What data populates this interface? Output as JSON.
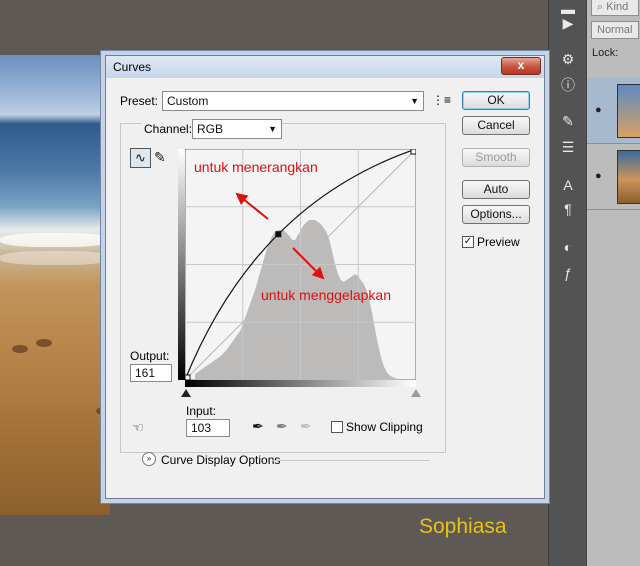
{
  "dialog": {
    "title": "Curves",
    "close_glyph": "x",
    "preset_label": "Preset:",
    "preset_value": "Custom",
    "channel_label": "Channel:",
    "channel_value": "RGB",
    "output_label": "Output:",
    "output_value": "161",
    "input_label": "Input:",
    "input_value": "103",
    "show_clipping_label": "Show Clipping",
    "show_clipping_checked": false,
    "curve_display_options_label": "Curve Display Options",
    "preview_label": "Preview",
    "preview_checked": true,
    "buttons": {
      "ok": "OK",
      "cancel": "Cancel",
      "smooth": "Smooth",
      "auto": "Auto",
      "options": "Options..."
    }
  },
  "annotations": {
    "brighten": "untuk menerangkan",
    "darken": "untuk menggelapkan"
  },
  "layers_panel": {
    "kind_placeholder": "Kind",
    "blend_mode": "Normal",
    "lock_label": "Lock:"
  },
  "watermark": "Sophiasa",
  "icons": {
    "curve_tool": "curve-point-icon",
    "pencil": "pencil-icon",
    "preset_menu": "preset-menu-icon",
    "hand": "on-image-adjust-icon",
    "eyedroppers": [
      "black-eyedropper-icon",
      "gray-eyedropper-icon",
      "white-eyedropper-icon"
    ]
  },
  "colors": {
    "annotation": "#e10e0e",
    "watermark": "#e6c21a",
    "titlebar": "#c6d6ea"
  },
  "chart_data": {
    "type": "line",
    "xlim": [
      0,
      255
    ],
    "ylim": [
      0,
      255
    ],
    "grid": true,
    "curve_points": [
      [
        0,
        0
      ],
      [
        103,
        161
      ],
      [
        255,
        255
      ]
    ],
    "histogram": [
      6,
      8,
      10,
      12,
      14,
      16,
      18,
      20,
      22,
      24,
      27,
      30,
      34,
      38,
      42,
      46,
      50,
      58,
      66,
      74,
      82,
      90,
      100,
      110,
      120,
      130,
      138,
      144,
      148,
      150,
      150,
      150,
      147,
      144,
      140,
      140,
      145,
      150,
      155,
      158,
      160,
      160,
      160,
      158,
      156,
      152,
      148,
      140,
      128,
      116,
      106,
      100,
      98,
      100,
      102,
      104,
      106,
      104,
      100,
      96,
      90,
      80,
      66,
      50,
      36,
      24,
      14,
      8,
      5,
      3,
      2,
      1
    ]
  }
}
